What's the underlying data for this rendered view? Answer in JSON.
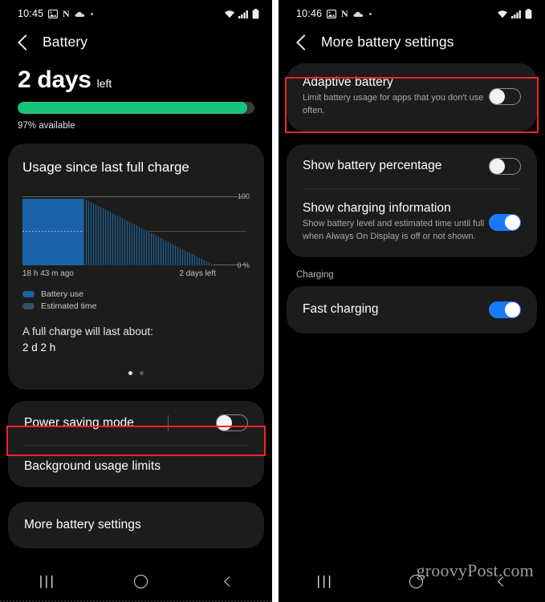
{
  "left": {
    "status": {
      "time": "10:45",
      "icons": [
        "image-icon",
        "nfc-icon",
        "cloud-icon",
        "dot-icon"
      ],
      "right_icons": [
        "wifi-icon",
        "signal-icon",
        "battery-icon"
      ]
    },
    "title": "Battery",
    "back_icon": "back-chevron-icon",
    "headline": {
      "value": "2 days",
      "suffix": "left"
    },
    "battery": {
      "percent_available": "97% available",
      "fill_percent": 97,
      "fill_color": "#17c37b"
    },
    "usage_card": {
      "title": "Usage since last full charge",
      "legend": [
        {
          "label": "Battery use",
          "style": "solid",
          "color": "#1a63ab"
        },
        {
          "label": "Estimated time",
          "style": "hatched",
          "color": "#2b4a63"
        }
      ],
      "full_charge_label": "A full charge will last about:",
      "full_charge_value": "2 d 2 h"
    },
    "rows": [
      {
        "label": "Power saving mode",
        "toggle": "off",
        "highlighted": true
      },
      {
        "label": "Background usage limits",
        "toggle": "none",
        "highlighted": false
      }
    ],
    "more_settings": {
      "label": "More battery settings"
    },
    "nav": {
      "recents": "|||",
      "home": "home-icon",
      "back": "back-icon"
    }
  },
  "right": {
    "status": {
      "time": "10:46"
    },
    "title": "More battery settings",
    "rows": [
      {
        "label": "Adaptive battery",
        "sub": "Limit battery usage for apps that you don't use often.",
        "toggle": "off",
        "highlighted": true
      },
      {
        "label": "Show battery percentage",
        "sub": "",
        "toggle": "off",
        "highlighted": false
      },
      {
        "label": "Show charging information",
        "sub": "Show battery level and estimated time until full when Always On Display is off or not shown.",
        "toggle": "on",
        "highlighted": false
      }
    ],
    "group_header": "Charging",
    "charging_row": {
      "label": "Fast charging",
      "toggle": "on"
    },
    "watermark": "groovyPost.com"
  },
  "chart_data": {
    "type": "area",
    "title": "Usage since last full charge",
    "xlabel": "",
    "ylabel": "",
    "ylim": [
      0,
      100
    ],
    "grid": true,
    "legend_position": "below",
    "axis_ticks": {
      "top": "100",
      "bottom": "0 %"
    },
    "x_ticks": [
      "18 h 43 m ago",
      "2 days left"
    ],
    "series": [
      {
        "name": "Battery use",
        "style": "solid",
        "color": "#1a63ab",
        "x": [
          0,
          30
        ],
        "values": [
          97,
          97
        ]
      },
      {
        "name": "Estimated time",
        "style": "hatched",
        "color": "#2b4a63",
        "x": [
          30,
          100
        ],
        "values": [
          97,
          0
        ]
      }
    ]
  }
}
